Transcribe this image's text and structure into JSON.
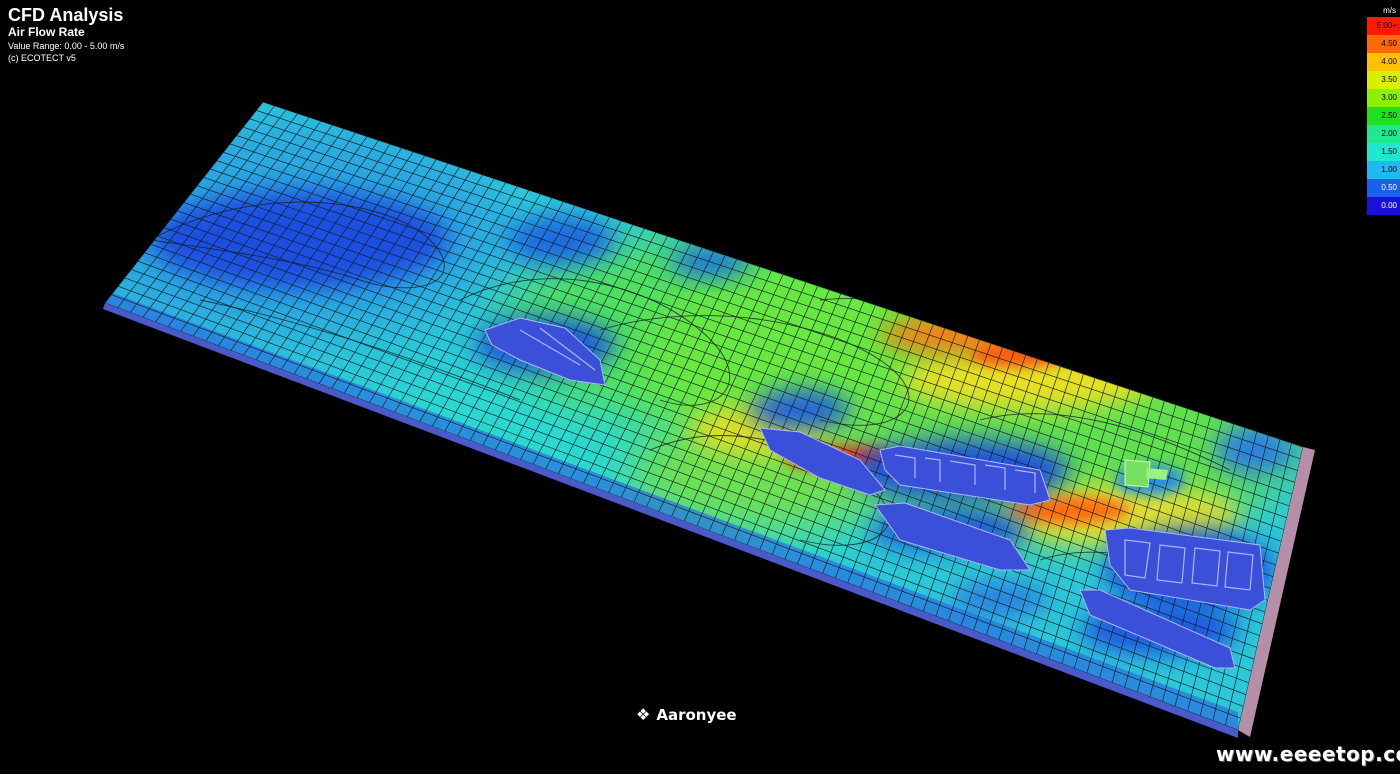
{
  "header": {
    "title": "CFD Analysis",
    "subtitle": "Air Flow Rate",
    "value_range": "Value Range: 0.00 - 5.00 m/s",
    "copyright": "(c) ECOTECT v5"
  },
  "legend": {
    "unit": "m/s",
    "items": [
      {
        "label": "5.00+",
        "color": "#ff1a00"
      },
      {
        "label": "4.50",
        "color": "#ff6a00"
      },
      {
        "label": "4.00",
        "color": "#ffc000"
      },
      {
        "label": "3.50",
        "color": "#d8f000"
      },
      {
        "label": "3.00",
        "color": "#8cf000"
      },
      {
        "label": "2.50",
        "color": "#20e020"
      },
      {
        "label": "2.00",
        "color": "#20e890"
      },
      {
        "label": "1.50",
        "color": "#20e8d0"
      },
      {
        "label": "1.00",
        "color": "#20b8f0"
      },
      {
        "label": "0.50",
        "color": "#1a60e8"
      },
      {
        "label": "0.00",
        "color": "#1a10d8"
      }
    ]
  },
  "signature": {
    "icon": "diamond-cluster-icon",
    "text": "Aaronyee"
  },
  "watermark": "www.eeeetop.com"
}
